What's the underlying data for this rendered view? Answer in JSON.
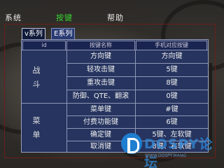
{
  "menu": {
    "items": [
      {
        "label": "系统",
        "active": false
      },
      {
        "label": "按键",
        "active": true
      },
      {
        "label": "帮助",
        "active": false
      }
    ]
  },
  "subtabs": [
    {
      "label": "v系列",
      "active": true
    },
    {
      "label": "E系列",
      "active": false
    }
  ],
  "table": {
    "headers": [
      "id",
      "按键名称",
      "手机对应按键"
    ],
    "groups": [
      {
        "label": "战斗",
        "rows": [
          {
            "name": "方向键",
            "key": "方向键"
          },
          {
            "name": "轻攻击键",
            "key": "5键"
          },
          {
            "name": "重攻击键",
            "key": "8键"
          },
          {
            "name": "防御、QTE、翻滚",
            "key": "0键"
          }
        ]
      },
      {
        "label": "菜单",
        "rows": [
          {
            "name": "菜单键",
            "key": "#键"
          },
          {
            "name": "付费功能键",
            "key": "6键"
          },
          {
            "name": "确定键",
            "key": "5键、左软键"
          },
          {
            "name": "取消键",
            "key": "8键、右软键"
          }
        ]
      }
    ]
  },
  "watermark": {
    "text": "DOSPY论坛",
    "url": "WWW.DOSPY.WANG"
  },
  "colors": {
    "active_menu": "#38d430",
    "table_bg": "#26345f"
  }
}
